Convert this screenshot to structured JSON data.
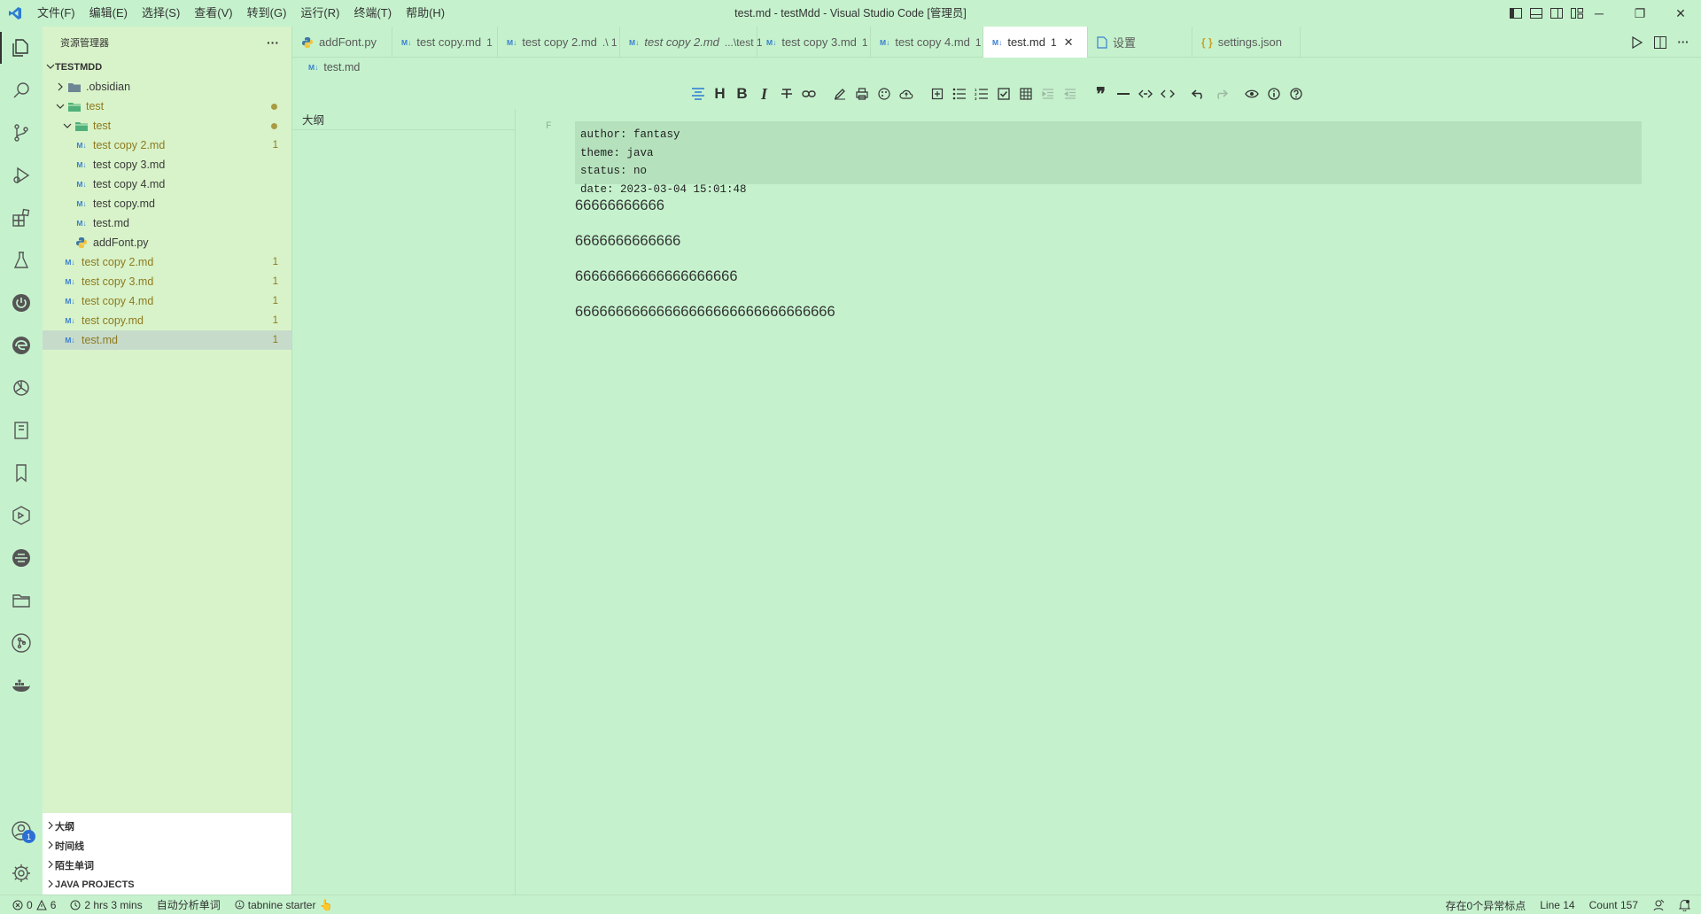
{
  "app": {
    "title": "test.md - testMdd - Visual Studio Code [管理员]",
    "accent": "#2b7bd6",
    "theme_bg": "#c5f2cd"
  },
  "menu": [
    "文件(F)",
    "编辑(E)",
    "选择(S)",
    "查看(V)",
    "转到(G)",
    "运行(R)",
    "终端(T)",
    "帮助(H)"
  ],
  "window_controls": {
    "minimize": "─",
    "restore": "❐",
    "close": "✕"
  },
  "sidebar": {
    "title": "资源管理器",
    "more": "···",
    "workspace": "TESTMDD",
    "tree": [
      {
        "label": ".obsidian",
        "type": "folder",
        "indent": 1,
        "collapsed": true
      },
      {
        "label": "test",
        "type": "folder",
        "indent": 1,
        "expanded": true,
        "dot": true,
        "modified": true
      },
      {
        "label": "test",
        "type": "folder",
        "indent": 2,
        "expanded": true,
        "dot": true,
        "modified": true
      },
      {
        "label": "test copy 2.md",
        "type": "md",
        "indent": 3,
        "count": "1",
        "modified": true
      },
      {
        "label": "test copy 3.md",
        "type": "md",
        "indent": 3
      },
      {
        "label": "test copy 4.md",
        "type": "md",
        "indent": 3
      },
      {
        "label": "test copy.md",
        "type": "md",
        "indent": 3
      },
      {
        "label": "test.md",
        "type": "md",
        "indent": 3
      },
      {
        "label": "addFont.py",
        "type": "py",
        "indent": 2
      },
      {
        "label": "test copy 2.md",
        "type": "md",
        "indent": 1,
        "count": "1",
        "modified": true
      },
      {
        "label": "test copy 3.md",
        "type": "md",
        "indent": 1,
        "count": "1",
        "modified": true
      },
      {
        "label": "test copy 4.md",
        "type": "md",
        "indent": 1,
        "count": "1",
        "modified": true
      },
      {
        "label": "test copy.md",
        "type": "md",
        "indent": 1,
        "count": "1",
        "modified": true
      },
      {
        "label": "test.md",
        "type": "md",
        "indent": 1,
        "count": "1",
        "modified": true,
        "selected": true
      }
    ],
    "panels": [
      "大纲",
      "时间线",
      "陌生单词",
      "JAVA PROJECTS"
    ]
  },
  "tabs": [
    {
      "label": "addFont.py",
      "icon": "py"
    },
    {
      "label": "test copy.md",
      "icon": "md",
      "count": "1"
    },
    {
      "label": "test copy 2.md",
      "icon": "md",
      "count": ".\\ 1"
    },
    {
      "label": "test copy 2.md",
      "icon": "md",
      "count": "...\\test 1",
      "italic": true
    },
    {
      "label": "test copy 3.md",
      "icon": "md",
      "count": "1"
    },
    {
      "label": "test copy 4.md",
      "icon": "md",
      "count": "1"
    },
    {
      "label": "test.md",
      "icon": "md",
      "count": "1",
      "active": true,
      "close": "✕"
    },
    {
      "label": "设置",
      "icon": "settings"
    },
    {
      "label": "settings.json",
      "icon": "json"
    }
  ],
  "md_icon_text": "M↓",
  "breadcrumb": {
    "file": "test.md"
  },
  "outline": {
    "label": "大纲"
  },
  "editor": {
    "gutter_marker": "F",
    "frontmatter": [
      "author: fantasy",
      "theme: java",
      "status: no",
      "date: 2023-03-04 15:01:48"
    ],
    "paragraphs": [
      "66666666666",
      "6666666666666",
      "66666666666666666666",
      "66666666666666666666666666666666"
    ]
  },
  "activity_badge": "1",
  "statusbar": {
    "errors": "0",
    "warnings": "6",
    "time": "2 hrs 3 mins",
    "analyze": "自动分析单词",
    "tabnine": "tabnine starter",
    "tabnine_emoji": "👆",
    "anomalies": "存在0个异常标点",
    "line": "Line 14",
    "count": "Count 157"
  }
}
